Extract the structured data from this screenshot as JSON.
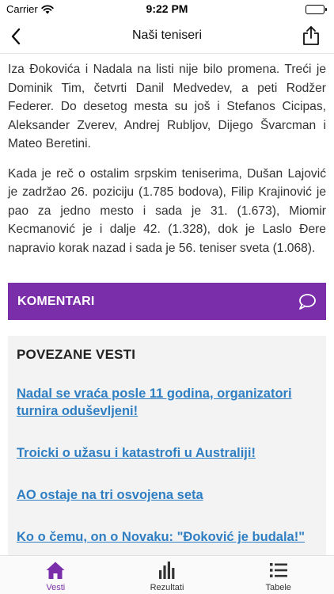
{
  "status_bar": {
    "carrier": "Carrier",
    "time": "9:22 PM"
  },
  "nav": {
    "title": "Naši teniseri"
  },
  "article": {
    "paragraphs": [
      "Iza Đokovića i Nadala na listi nije bilo promena. Treći je Dominik Tim, četvrti Danil Medvedev, a peti Rodžer Federer. Do desetog mesta su još i Stefanos Cicipas, Aleksander Zverev, Andrej Rubljov, Dijego Švarcman i Mateo Beretini.",
      "Kada je reč o ostalim srpskim teniserima, Dušan Lajović je zadržao 26. poziciju (1.785 bodova), Filip Krajinović je pao za jedno mesto i sada je 31. (1.673), Miomir Kecmanović je i dalje 42. (1.328), dok je Laslo Đere napravio korak nazad i sada je 56. teniser sveta (1.068)."
    ]
  },
  "comments": {
    "label": "KOMENTARI"
  },
  "related": {
    "title": "POVEZANE VESTI",
    "links": [
      "Nadal se vraća posle 11 godina, organizatori turnira oduševljeni!",
      "Troicki o užasu i katastrofi u Australiji!",
      "AO ostaje na tri osvojena seta",
      "Ko o čemu, on o Novaku: \"Đoković je budala!\""
    ]
  },
  "tabs": [
    {
      "label": "Vesti",
      "icon": "home-icon",
      "active": true
    },
    {
      "label": "Rezultati",
      "icon": "bar-chart-icon",
      "active": false
    },
    {
      "label": "Tabele",
      "icon": "list-icon",
      "active": false
    }
  ],
  "colors": {
    "accent": "#7a2ea9",
    "link": "#2f7ec2"
  }
}
